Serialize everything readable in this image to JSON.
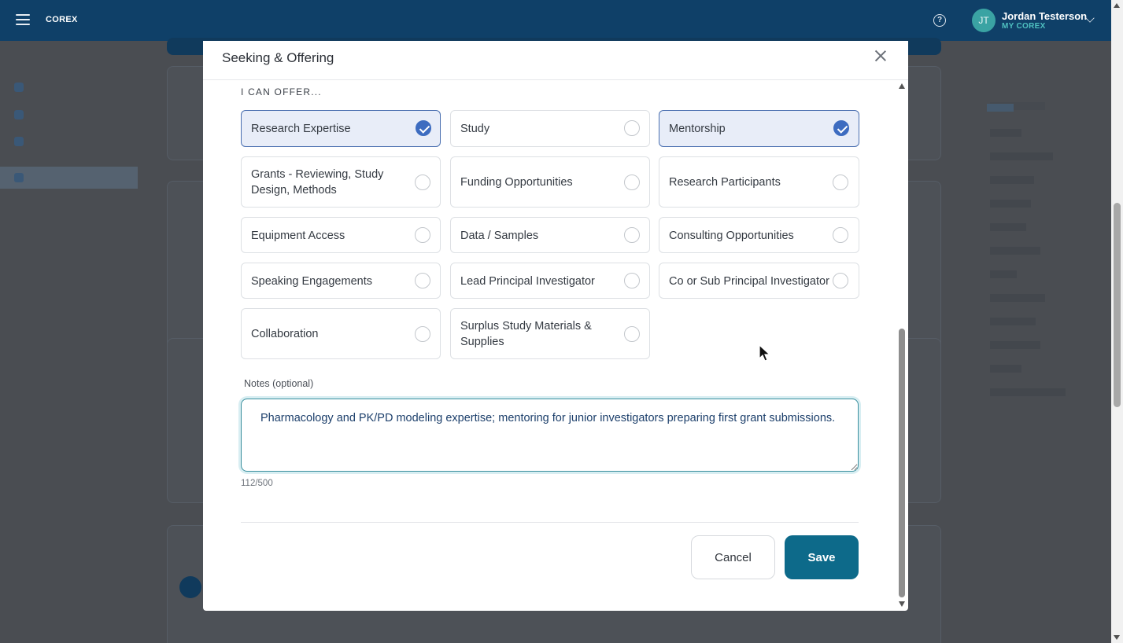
{
  "topbar": {
    "brand": "COREX",
    "user_initials": "JT",
    "user_name": "Jordan Testerson",
    "user_subtitle": "MY COREX",
    "colors": {
      "bar": "#0f4068",
      "accent": "#4fc0c0"
    }
  },
  "modal": {
    "title": "Seeking & Offering",
    "section_label": "I CAN OFFER...",
    "options": [
      {
        "label": "Research Expertise",
        "selected": true
      },
      {
        "label": "Study",
        "selected": false
      },
      {
        "label": "Mentorship",
        "selected": true
      },
      {
        "label": "Grants - Reviewing, Study Design, Methods",
        "selected": false
      },
      {
        "label": "Funding Opportunities",
        "selected": false
      },
      {
        "label": "Research Participants",
        "selected": false
      },
      {
        "label": "Equipment Access",
        "selected": false
      },
      {
        "label": "Data / Samples",
        "selected": false
      },
      {
        "label": "Consulting Opportunities",
        "selected": false
      },
      {
        "label": "Speaking Engagements",
        "selected": false
      },
      {
        "label": "Lead Principal Investigator",
        "selected": false
      },
      {
        "label": "Co or Sub Principal Investigator",
        "selected": false
      },
      {
        "label": "Collaboration",
        "selected": false
      },
      {
        "label": "Surplus Study Materials & Supplies",
        "selected": false
      }
    ],
    "notes_label": "Notes (optional)",
    "notes_value": "Pharmacology and PK/PD modeling expertise; mentoring for junior investigators preparing first grant submissions.",
    "char_count": "112/500",
    "cancel_label": "Cancel",
    "save_label": "Save",
    "colors": {
      "primary": "#0d6a8a",
      "selected_bg": "#e8edf8",
      "check": "#3d6cc0"
    }
  }
}
